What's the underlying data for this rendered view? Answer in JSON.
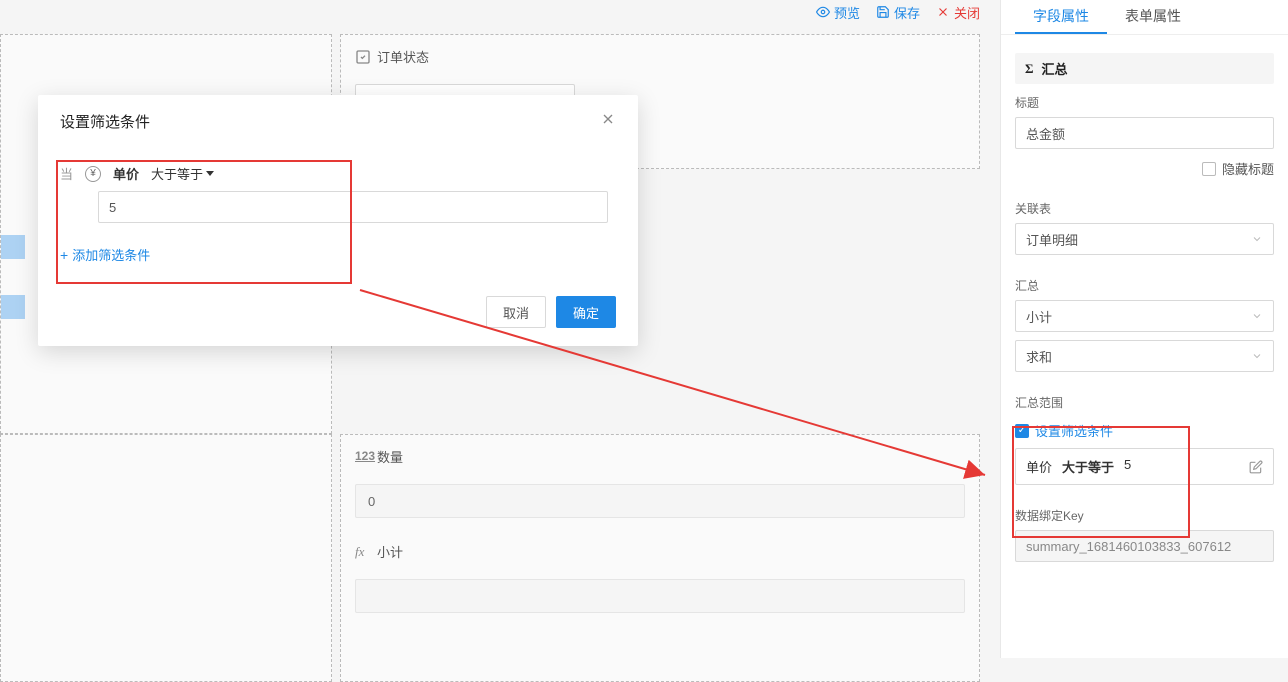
{
  "toolbar": {
    "preview": "预览",
    "save": "保存",
    "close": "关闭"
  },
  "canvas": {
    "order_status": {
      "title": "订单状态"
    },
    "quantity": {
      "title": "数量",
      "value": "0"
    },
    "subtotal": {
      "title": "小计"
    }
  },
  "modal": {
    "title": "设置筛选条件",
    "when": "当",
    "field": "单价",
    "operator": "大于等于",
    "value": "5",
    "add_condition": "添加筛选条件",
    "cancel": "取消",
    "confirm": "确定"
  },
  "right_panel": {
    "tabs": {
      "field_props": "字段属性",
      "form_props": "表单属性"
    },
    "summary_header": "汇总",
    "title_label": "标题",
    "title_value": "总金额",
    "hide_title": "隐藏标题",
    "related_table_label": "关联表",
    "related_table_value": "订单明细",
    "summary_label": "汇总",
    "summary_field": "小计",
    "summary_agg": "求和",
    "summary_range_label": "汇总范围",
    "set_filter": "设置筛选条件",
    "filter_field": "单价",
    "filter_op": "大于等于",
    "filter_val": "5",
    "bind_key_label": "数据绑定Key",
    "bind_key_value": "summary_1681460103833_607612"
  }
}
